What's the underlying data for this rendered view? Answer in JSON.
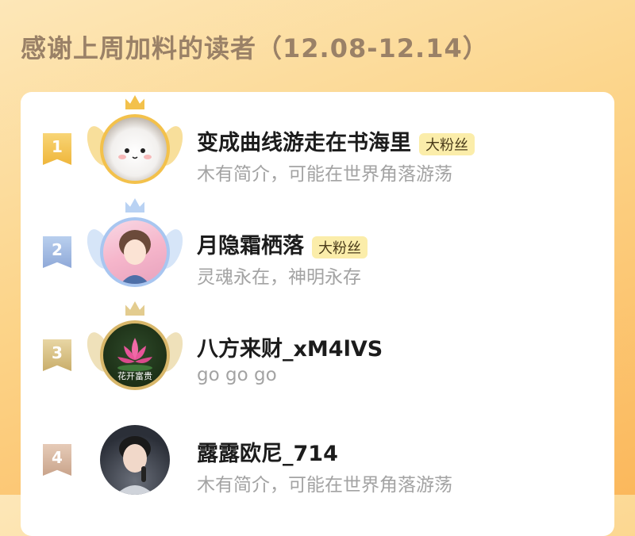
{
  "header": {
    "title": "感谢上周加料的读者（12.08-12.14）"
  },
  "readers": [
    {
      "rank": "1",
      "name": "变成曲线游走在书海里",
      "badge": "大粉丝",
      "bio": "木有简介，可能在世界角落游荡",
      "avatar_icon": "white-cat-avatar-icon",
      "frame": "gold"
    },
    {
      "rank": "2",
      "name": "月隐霜栖落",
      "badge": "大粉丝",
      "bio": "灵魂永在，神明永存",
      "avatar_icon": "anime-boy-avatar-icon",
      "frame": "silver"
    },
    {
      "rank": "3",
      "name": "八方来财_xM4lVS",
      "badge": "",
      "bio": "go go go",
      "avatar_icon": "lotus-avatar-icon",
      "avatar_caption": "花开富贵",
      "frame": "bronze"
    },
    {
      "rank": "4",
      "name": "露露欧尼_714",
      "badge": "",
      "bio": "木有简介，可能在世界角落游荡",
      "avatar_icon": "singer-avatar-icon",
      "frame": "none"
    }
  ],
  "colors": {
    "gold": "#f3c14b",
    "silver": "#a8c6f0",
    "bronze": "#d8b76a",
    "badge_bg": "#fbedaa",
    "title": "#9a8167"
  }
}
